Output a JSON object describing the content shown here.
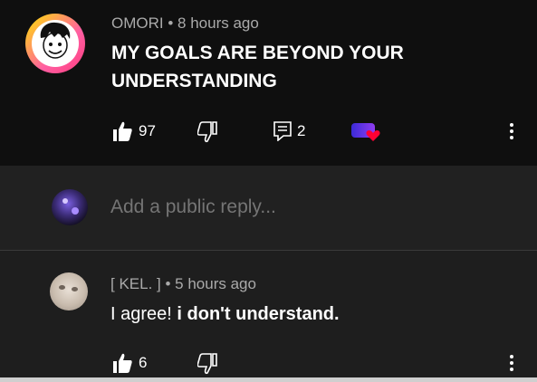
{
  "comment": {
    "author": "OMORI",
    "separator": "•",
    "time": "8 hours ago",
    "text": "MY GOALS ARE BEYOND YOUR UNDERSTANDING",
    "likes": "97",
    "replies": "2"
  },
  "reply_box": {
    "placeholder": "Add a public reply..."
  },
  "reply": {
    "author": "[ KEL. ]",
    "separator": "•",
    "time": "5 hours ago",
    "text_plain": "I agree! ",
    "text_bold": "i don't understand.",
    "likes": "6"
  },
  "icons": {
    "like": "thumbs-up-icon",
    "dislike": "thumbs-down-icon",
    "reply": "reply-icon",
    "more": "more-vert-icon",
    "heart": "creator-heart-icon"
  },
  "colors": {
    "background": "#0f0f0f",
    "reply_bar": "#212121",
    "meta": "#aaaaaa",
    "heart": "#ff0033"
  }
}
